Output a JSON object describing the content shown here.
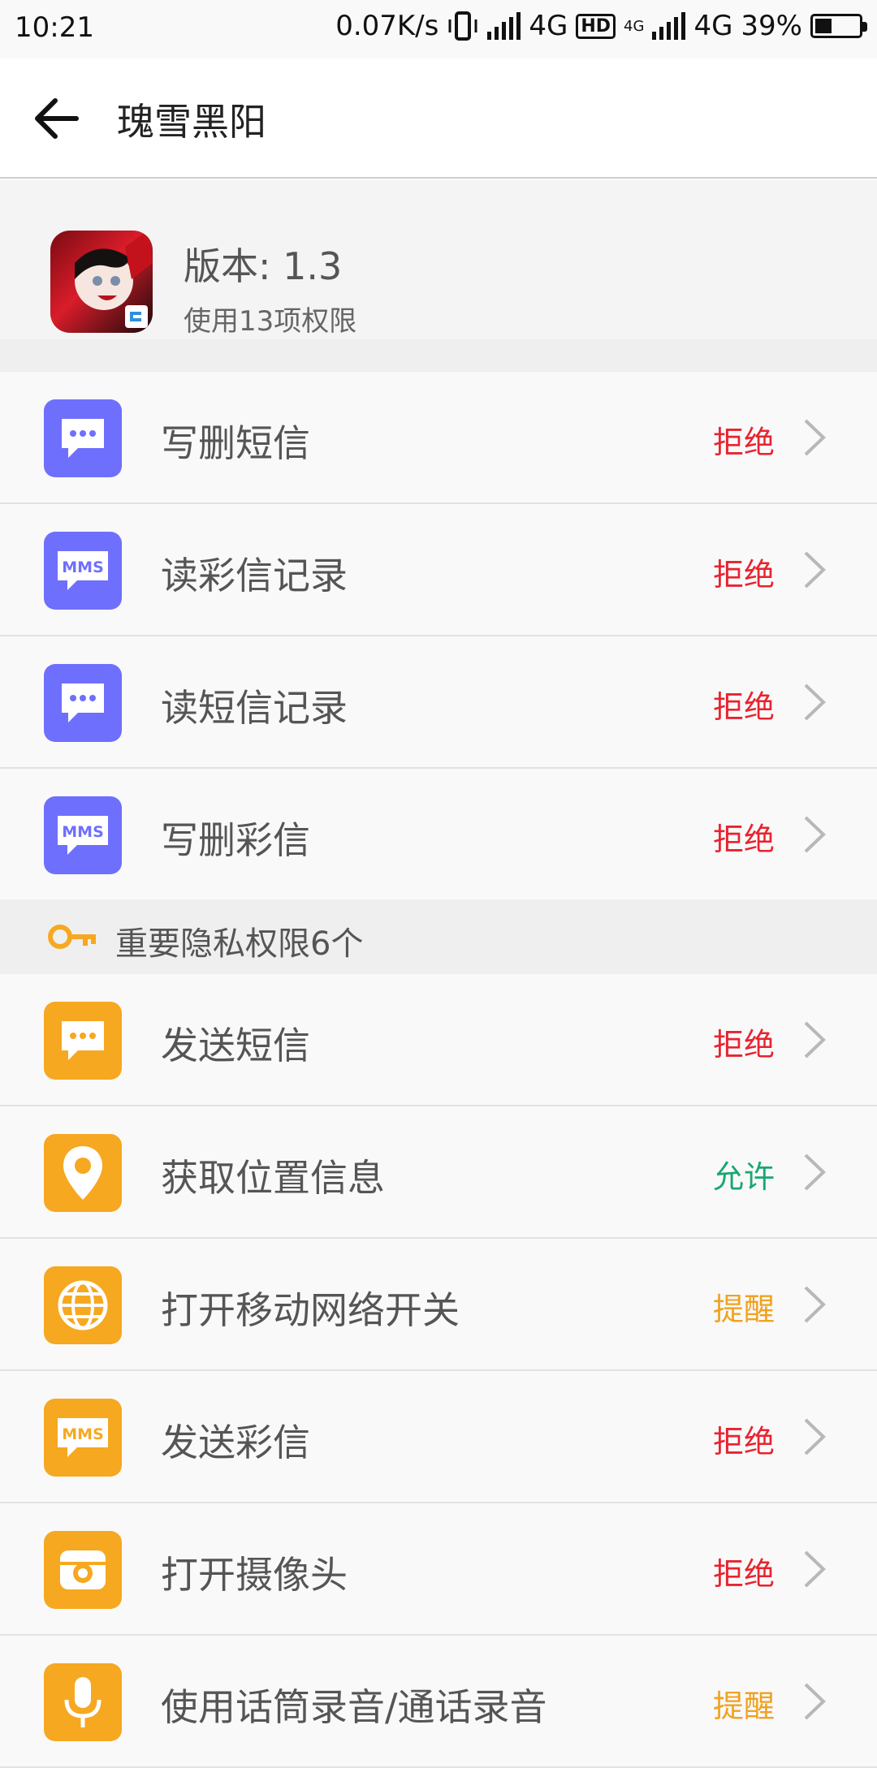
{
  "status_bar": {
    "time": "10:21",
    "net_speed": "0.07K/s",
    "net1": "4G",
    "hd": "HD",
    "net2_small": "4G",
    "net2": "4G",
    "battery": "39%",
    "battery_level": 0.39
  },
  "header": {
    "title": "瑰雪黑阳"
  },
  "app_info": {
    "version": "版本: 1.3",
    "permissions": "使用13项权限"
  },
  "sections": {
    "important": "重要隐私权限6个"
  },
  "sms_group": [
    {
      "label": "写删短信",
      "status": "拒绝",
      "icon": "message-icon"
    },
    {
      "label": "读彩信记录",
      "status": "拒绝",
      "icon": "mms-icon"
    },
    {
      "label": "读短信记录",
      "status": "拒绝",
      "icon": "message-icon"
    },
    {
      "label": "写删彩信",
      "status": "拒绝",
      "icon": "mms-icon"
    }
  ],
  "important_group": [
    {
      "label": "发送短信",
      "status": "拒绝",
      "icon": "message-icon"
    },
    {
      "label": "获取位置信息",
      "status": "允许",
      "icon": "location-icon"
    },
    {
      "label": "打开移动网络开关",
      "status": "提醒",
      "icon": "globe-icon"
    },
    {
      "label": "发送彩信",
      "status": "拒绝",
      "icon": "mms-icon"
    },
    {
      "label": "打开摄像头",
      "status": "拒绝",
      "icon": "camera-icon"
    },
    {
      "label": "使用话筒录音/通话录音",
      "status": "提醒",
      "icon": "microphone-icon"
    }
  ],
  "icon_text": {
    "mms": "MMS"
  },
  "colors": {
    "purple": "#6f6ffd",
    "orange": "#f6a821",
    "reject": "#e8232f",
    "allow": "#18a870",
    "remind": "#f0a221"
  }
}
